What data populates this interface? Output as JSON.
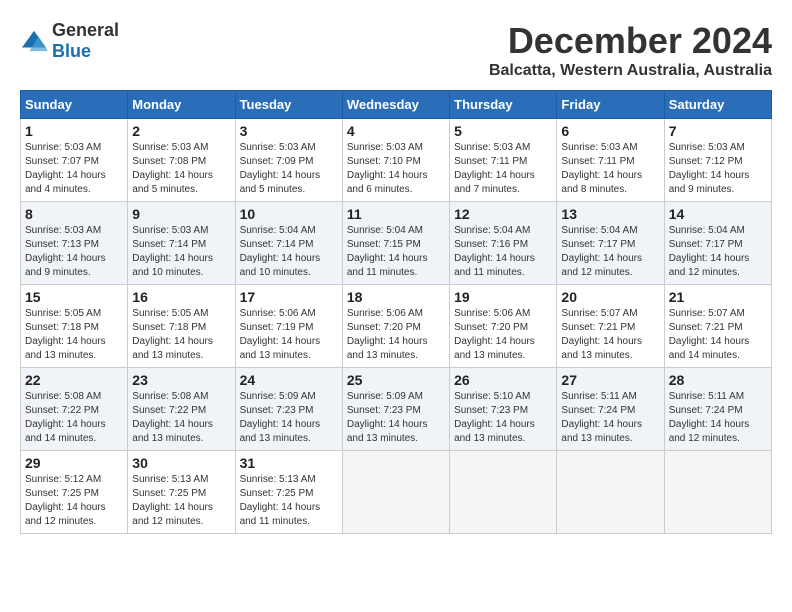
{
  "header": {
    "logo": {
      "text1": "General",
      "text2": "Blue"
    },
    "title": "December 2024",
    "subtitle": "Balcatta, Western Australia, Australia"
  },
  "weekdays": [
    "Sunday",
    "Monday",
    "Tuesday",
    "Wednesday",
    "Thursday",
    "Friday",
    "Saturday"
  ],
  "weeks": [
    [
      {
        "day": "1",
        "info": "Sunrise: 5:03 AM\nSunset: 7:07 PM\nDaylight: 14 hours\nand 4 minutes."
      },
      {
        "day": "2",
        "info": "Sunrise: 5:03 AM\nSunset: 7:08 PM\nDaylight: 14 hours\nand 5 minutes."
      },
      {
        "day": "3",
        "info": "Sunrise: 5:03 AM\nSunset: 7:09 PM\nDaylight: 14 hours\nand 5 minutes."
      },
      {
        "day": "4",
        "info": "Sunrise: 5:03 AM\nSunset: 7:10 PM\nDaylight: 14 hours\nand 6 minutes."
      },
      {
        "day": "5",
        "info": "Sunrise: 5:03 AM\nSunset: 7:11 PM\nDaylight: 14 hours\nand 7 minutes."
      },
      {
        "day": "6",
        "info": "Sunrise: 5:03 AM\nSunset: 7:11 PM\nDaylight: 14 hours\nand 8 minutes."
      },
      {
        "day": "7",
        "info": "Sunrise: 5:03 AM\nSunset: 7:12 PM\nDaylight: 14 hours\nand 9 minutes."
      }
    ],
    [
      {
        "day": "8",
        "info": "Sunrise: 5:03 AM\nSunset: 7:13 PM\nDaylight: 14 hours\nand 9 minutes."
      },
      {
        "day": "9",
        "info": "Sunrise: 5:03 AM\nSunset: 7:14 PM\nDaylight: 14 hours\nand 10 minutes."
      },
      {
        "day": "10",
        "info": "Sunrise: 5:04 AM\nSunset: 7:14 PM\nDaylight: 14 hours\nand 10 minutes."
      },
      {
        "day": "11",
        "info": "Sunrise: 5:04 AM\nSunset: 7:15 PM\nDaylight: 14 hours\nand 11 minutes."
      },
      {
        "day": "12",
        "info": "Sunrise: 5:04 AM\nSunset: 7:16 PM\nDaylight: 14 hours\nand 11 minutes."
      },
      {
        "day": "13",
        "info": "Sunrise: 5:04 AM\nSunset: 7:17 PM\nDaylight: 14 hours\nand 12 minutes."
      },
      {
        "day": "14",
        "info": "Sunrise: 5:04 AM\nSunset: 7:17 PM\nDaylight: 14 hours\nand 12 minutes."
      }
    ],
    [
      {
        "day": "15",
        "info": "Sunrise: 5:05 AM\nSunset: 7:18 PM\nDaylight: 14 hours\nand 13 minutes."
      },
      {
        "day": "16",
        "info": "Sunrise: 5:05 AM\nSunset: 7:18 PM\nDaylight: 14 hours\nand 13 minutes."
      },
      {
        "day": "17",
        "info": "Sunrise: 5:06 AM\nSunset: 7:19 PM\nDaylight: 14 hours\nand 13 minutes."
      },
      {
        "day": "18",
        "info": "Sunrise: 5:06 AM\nSunset: 7:20 PM\nDaylight: 14 hours\nand 13 minutes."
      },
      {
        "day": "19",
        "info": "Sunrise: 5:06 AM\nSunset: 7:20 PM\nDaylight: 14 hours\nand 13 minutes."
      },
      {
        "day": "20",
        "info": "Sunrise: 5:07 AM\nSunset: 7:21 PM\nDaylight: 14 hours\nand 13 minutes."
      },
      {
        "day": "21",
        "info": "Sunrise: 5:07 AM\nSunset: 7:21 PM\nDaylight: 14 hours\nand 14 minutes."
      }
    ],
    [
      {
        "day": "22",
        "info": "Sunrise: 5:08 AM\nSunset: 7:22 PM\nDaylight: 14 hours\nand 14 minutes."
      },
      {
        "day": "23",
        "info": "Sunrise: 5:08 AM\nSunset: 7:22 PM\nDaylight: 14 hours\nand 13 minutes."
      },
      {
        "day": "24",
        "info": "Sunrise: 5:09 AM\nSunset: 7:23 PM\nDaylight: 14 hours\nand 13 minutes."
      },
      {
        "day": "25",
        "info": "Sunrise: 5:09 AM\nSunset: 7:23 PM\nDaylight: 14 hours\nand 13 minutes."
      },
      {
        "day": "26",
        "info": "Sunrise: 5:10 AM\nSunset: 7:23 PM\nDaylight: 14 hours\nand 13 minutes."
      },
      {
        "day": "27",
        "info": "Sunrise: 5:11 AM\nSunset: 7:24 PM\nDaylight: 14 hours\nand 13 minutes."
      },
      {
        "day": "28",
        "info": "Sunrise: 5:11 AM\nSunset: 7:24 PM\nDaylight: 14 hours\nand 12 minutes."
      }
    ],
    [
      {
        "day": "29",
        "info": "Sunrise: 5:12 AM\nSunset: 7:25 PM\nDaylight: 14 hours\nand 12 minutes."
      },
      {
        "day": "30",
        "info": "Sunrise: 5:13 AM\nSunset: 7:25 PM\nDaylight: 14 hours\nand 12 minutes."
      },
      {
        "day": "31",
        "info": "Sunrise: 5:13 AM\nSunset: 7:25 PM\nDaylight: 14 hours\nand 11 minutes."
      },
      {
        "day": "",
        "info": ""
      },
      {
        "day": "",
        "info": ""
      },
      {
        "day": "",
        "info": ""
      },
      {
        "day": "",
        "info": ""
      }
    ]
  ]
}
